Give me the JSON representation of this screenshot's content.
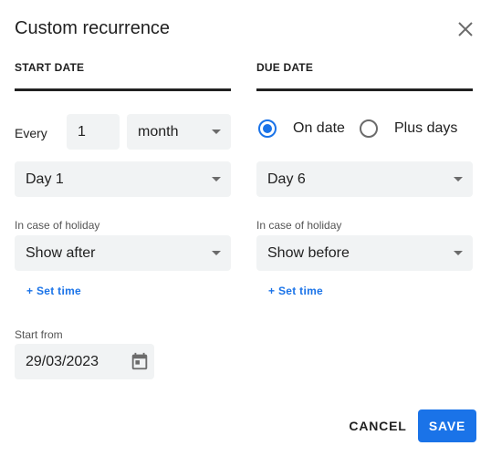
{
  "dialog": {
    "title": "Custom recurrence",
    "close_icon": "close-icon"
  },
  "start": {
    "header": "START DATE",
    "every_label": "Every",
    "every_value": "1",
    "unit_value": "month",
    "day_value": "Day 1",
    "holiday_label": "In case of holiday",
    "holiday_value": "Show after",
    "set_time": "+ Set time",
    "start_from_label": "Start from",
    "start_from_value": "29/03/2023",
    "calendar_icon": "calendar-icon"
  },
  "due": {
    "header": "DUE DATE",
    "radio_on_date": "On date",
    "radio_plus_days": "Plus days",
    "selected_mode": "On date",
    "day_value": "Day 6",
    "holiday_label": "In case of holiday",
    "holiday_value": "Show before",
    "set_time": "+ Set time"
  },
  "actions": {
    "cancel": "CANCEL",
    "save": "SAVE"
  },
  "colors": {
    "accent": "#1a73e8",
    "field_bg": "#f1f3f4",
    "text": "#212121"
  }
}
